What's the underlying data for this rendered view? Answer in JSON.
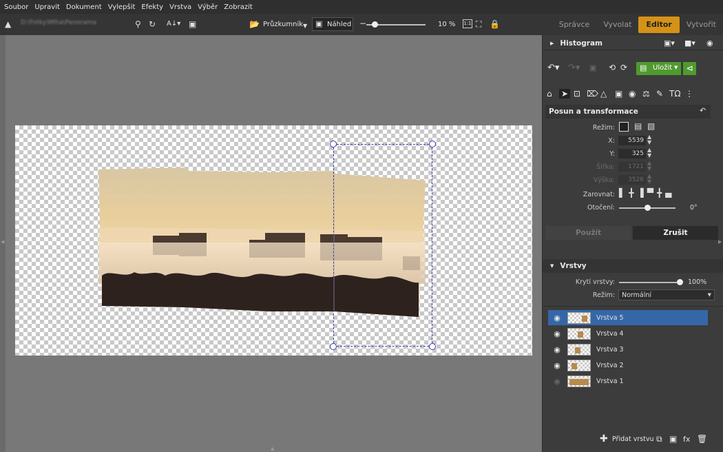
{
  "menu": [
    "Soubor",
    "Upravit",
    "Dokument",
    "Vylepšit",
    "Efekty",
    "Vrstva",
    "Výběr",
    "Zobrazit"
  ],
  "toolbar": {
    "path_text": "D:\\Fotky\\Mlha\\Panorama",
    "explorer_label": "Průzkumník",
    "preview_label": "Náhled",
    "zoom": "10 %",
    "zoom_fraction": 0.15,
    "actual_size_label": "1:1"
  },
  "mode_tabs": [
    {
      "label": "Správce",
      "active": false
    },
    {
      "label": "Vyvolat",
      "active": false
    },
    {
      "label": "Editor",
      "active": true
    },
    {
      "label": "Vytvořit",
      "active": false
    }
  ],
  "histogram": {
    "title": "Histogram"
  },
  "actions": {
    "save_label": "Uložit"
  },
  "transform": {
    "title": "Posun a transformace",
    "mode_label": "Režim:",
    "x_label": "X:",
    "x_value": "5539",
    "y_label": "Y:",
    "y_value": "325",
    "width_label": "Šířka:",
    "width_value": "1721",
    "height_label": "Výška:",
    "height_value": "3526",
    "align_label": "Zarovnat:",
    "rotation_label": "Otočení:",
    "rotation_value": "0°",
    "rotation_fraction": 0.5,
    "apply_label": "Použít",
    "cancel_label": "Zrušit"
  },
  "layers": {
    "title": "Vrstvy",
    "opacity_label": "Krytí vrstvy:",
    "opacity_value": "100%",
    "opacity_fraction": 1.0,
    "blend_label": "Režim:",
    "blend_value": "Normální",
    "items": [
      {
        "name": "Vrstva 5",
        "visible": true,
        "selected": true
      },
      {
        "name": "Vrstva 4",
        "visible": true,
        "selected": false
      },
      {
        "name": "Vrstva 3",
        "visible": true,
        "selected": false
      },
      {
        "name": "Vrstva 2",
        "visible": true,
        "selected": false
      },
      {
        "name": "Vrstva 1",
        "visible": false,
        "selected": false
      }
    ],
    "add_layer_label": "Přidat vrstvu"
  },
  "colors": {
    "accent": "#d49317",
    "selection": "#3567a8",
    "save_green": "#4f9a2f",
    "workspace": "#787878"
  }
}
